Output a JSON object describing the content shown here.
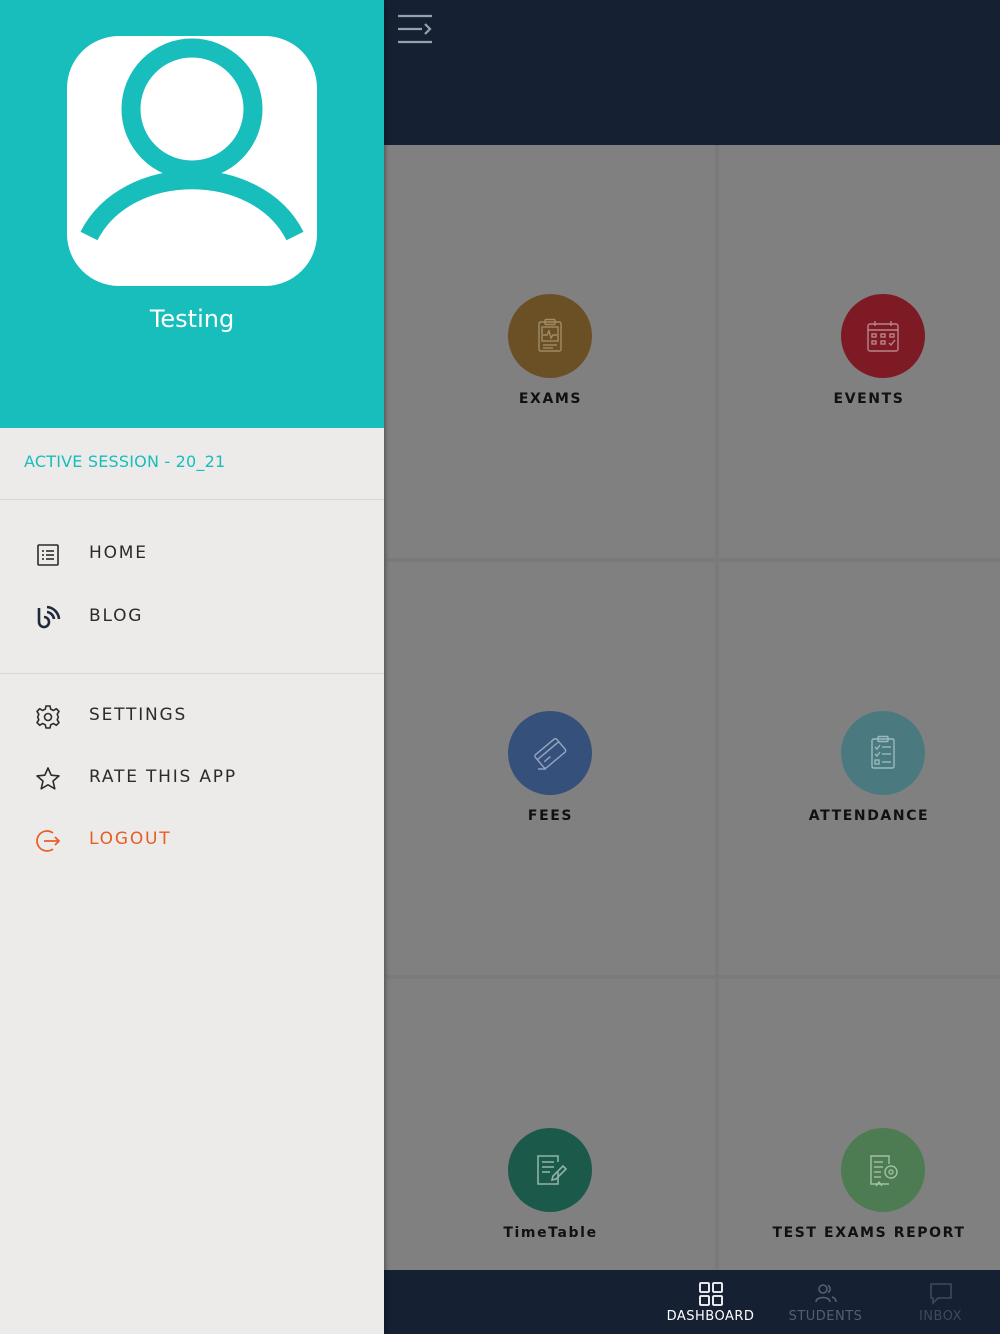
{
  "colors": {
    "teal": "#17bebb",
    "navy": "#152033",
    "drawer_bg": "#ecebea",
    "logout": "#e85d20",
    "exams": "#6b5025",
    "events": "#7d1a24",
    "fees": "#35507a",
    "attendance": "#4a7a80",
    "timetable": "#1b5a4a",
    "test_exams_report": "#4d7c52"
  },
  "drawer": {
    "profile_name": "Testing",
    "session": "ACTIVE SESSION - 20_21",
    "menu": [
      {
        "label": "HOME",
        "icon": "list-icon"
      },
      {
        "label": "BLOG",
        "icon": "blog-icon"
      },
      {
        "label": "SETTINGS",
        "icon": "gear-icon"
      },
      {
        "label": "RATE THIS APP",
        "icon": "star-icon"
      },
      {
        "label": "LOGOUT",
        "icon": "logout-icon"
      }
    ]
  },
  "dashboard": {
    "tiles": [
      {
        "label": "EXAMS",
        "icon": "clipboard-pulse-icon"
      },
      {
        "label": "EVENTS",
        "icon": "calendar-icon"
      },
      {
        "label": "FEES",
        "icon": "card-icon"
      },
      {
        "label": "ATTENDANCE",
        "icon": "checklist-icon"
      },
      {
        "label": "TimeTable",
        "icon": "note-edit-icon"
      },
      {
        "label": "TEST EXAMS REPORT",
        "icon": "report-icon"
      }
    ]
  },
  "bottom_nav": [
    {
      "label": "DASHBOARD",
      "icon": "grid-icon",
      "color": "#ffffff"
    },
    {
      "label": "STUDENTS",
      "icon": "users-icon",
      "color": "#555f70"
    },
    {
      "label": "INBOX",
      "icon": "chat-icon",
      "color": "#3f4a5a"
    }
  ]
}
